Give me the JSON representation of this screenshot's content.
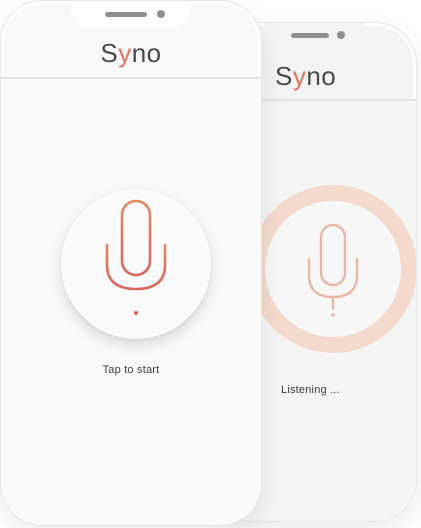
{
  "front_phone": {
    "app_logo": {
      "prefix": "S",
      "accent": "y",
      "suffix": "no"
    },
    "status": "Tap to start"
  },
  "back_phone": {
    "app_logo": {
      "prefix": "S",
      "accent": "y",
      "suffix": "no"
    },
    "status": "Listening ..."
  },
  "icons": {
    "mic_start": "microphone-icon",
    "mic_listening": "microphone-icon"
  },
  "colors": {
    "accent": "#e0745d",
    "accent_soft": "#f3dacd",
    "mic_gradient_top": "#e08a62",
    "mic_gradient_bottom": "#d9665e",
    "mic_listening": "#e9b7a6",
    "logo_text": "#4a4a4a"
  }
}
